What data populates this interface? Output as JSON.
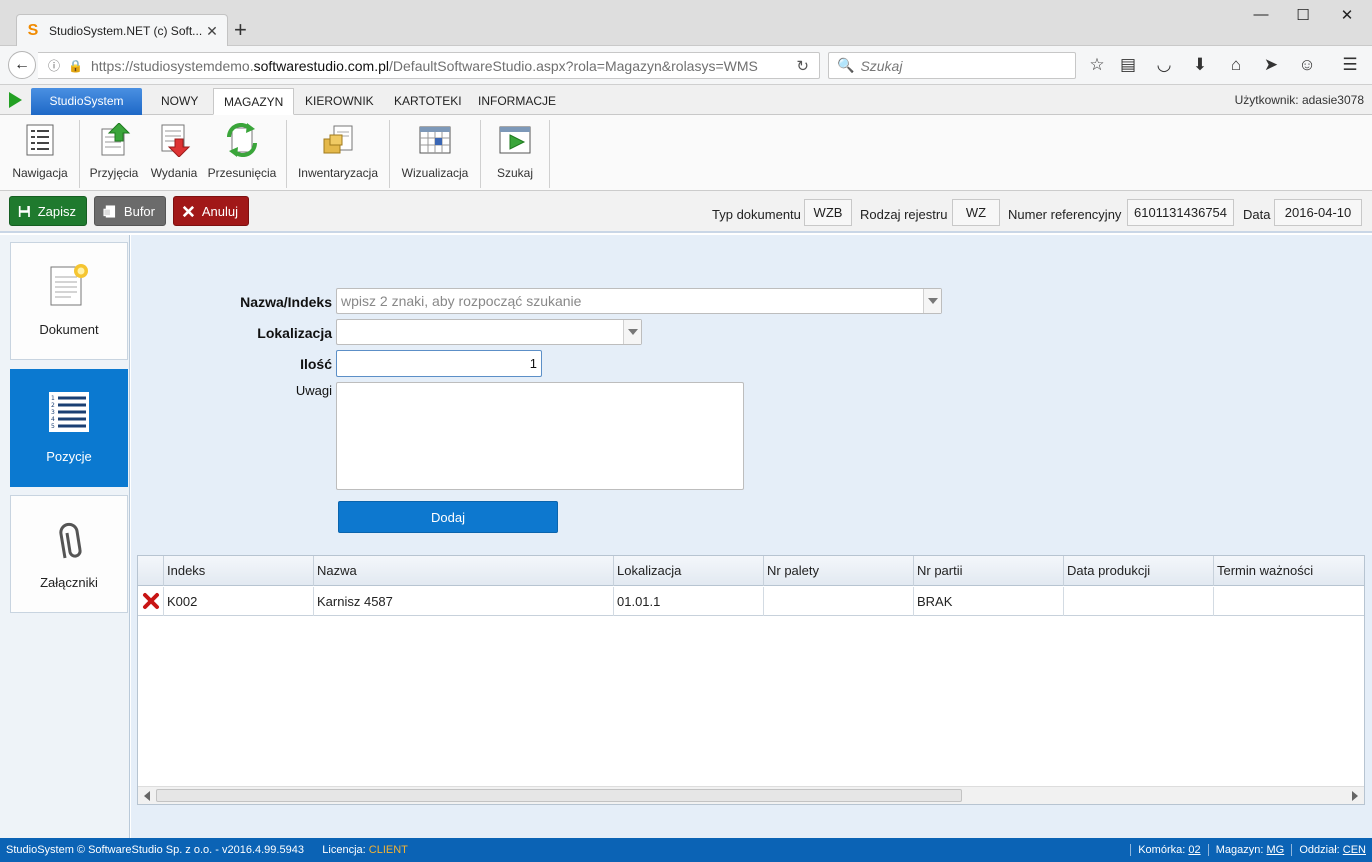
{
  "browser": {
    "tab_title": "StudioSystem.NET (c) Soft...",
    "url_prefix": "https://studiosystemdemo.",
    "url_domain": "softwarestudio.com.pl",
    "url_path": "/DefaultSoftwareStudio.aspx?rola=Magazyn&rolasys=WMS",
    "search_placeholder": "Szukaj"
  },
  "menu": {
    "brand": "StudioSystem",
    "items": [
      {
        "label": "NOWY"
      },
      {
        "label": "MAGAZYN"
      },
      {
        "label": "KIEROWNIK"
      },
      {
        "label": "KARTOTEKI"
      },
      {
        "label": "INFORMACJE"
      }
    ],
    "active": "MAGAZYN",
    "user": "Użytkownik: adasie3078"
  },
  "ribbon": {
    "nawigacja": "Nawigacja",
    "przyjecia": "Przyjęcia",
    "wydania": "Wydania",
    "przesuniecia": "Przesunięcia",
    "inwentaryzacja": "Inwentaryzacja",
    "wizualizacja": "Wizualizacja",
    "szukaj": "Szukaj"
  },
  "actions": {
    "zapisz": "Zapisz",
    "bufor": "Bufor",
    "anuluj": "Anuluj"
  },
  "doc": {
    "typ_label": "Typ dokumentu",
    "typ_value": "WZB",
    "rodzaj_label": "Rodzaj rejestru",
    "rodzaj_value": "WZ",
    "numer_label": "Numer referencyjny",
    "numer_value": "6101131436754",
    "data_label": "Data",
    "data_value": "2016-04-10"
  },
  "sidebar": {
    "dokument": "Dokument",
    "pozycje": "Pozycje",
    "zalaczniki": "Załączniki"
  },
  "form": {
    "nazwa_label": "Nazwa/Indeks",
    "nazwa_placeholder": "wpisz 2 znaki, aby rozpocząć szukanie",
    "lokalizacja_label": "Lokalizacja",
    "lokalizacja_value": "",
    "ilosc_label": "Ilość",
    "ilosc_value": "1",
    "uwagi_label": "Uwagi",
    "uwagi_value": "",
    "dodaj": "Dodaj"
  },
  "grid": {
    "columns": [
      "Indeks",
      "Nazwa",
      "Lokalizacja",
      "Nr palety",
      "Nr partii",
      "Data produkcji",
      "Termin ważności"
    ],
    "rows": [
      {
        "indeks": "K002",
        "nazwa": "Karnisz 4587",
        "lokalizacja": "01.01.1",
        "nr_palety": "",
        "nr_partii": "BRAK",
        "data_produkcji": "",
        "termin_waznosci": ""
      }
    ]
  },
  "footer": {
    "copyright": "StudioSystem © SoftwareStudio Sp. z o.o. - v2016.4.99.5943",
    "licencja_label": "Licencja:",
    "licencja_value": "CLIENT",
    "komorka_label": "Komórka:",
    "komorka_value": "02",
    "magazyn_label": "Magazyn:",
    "magazyn_value": "MG",
    "oddzial_label": "Oddział:",
    "oddzial_value": "CEN"
  }
}
